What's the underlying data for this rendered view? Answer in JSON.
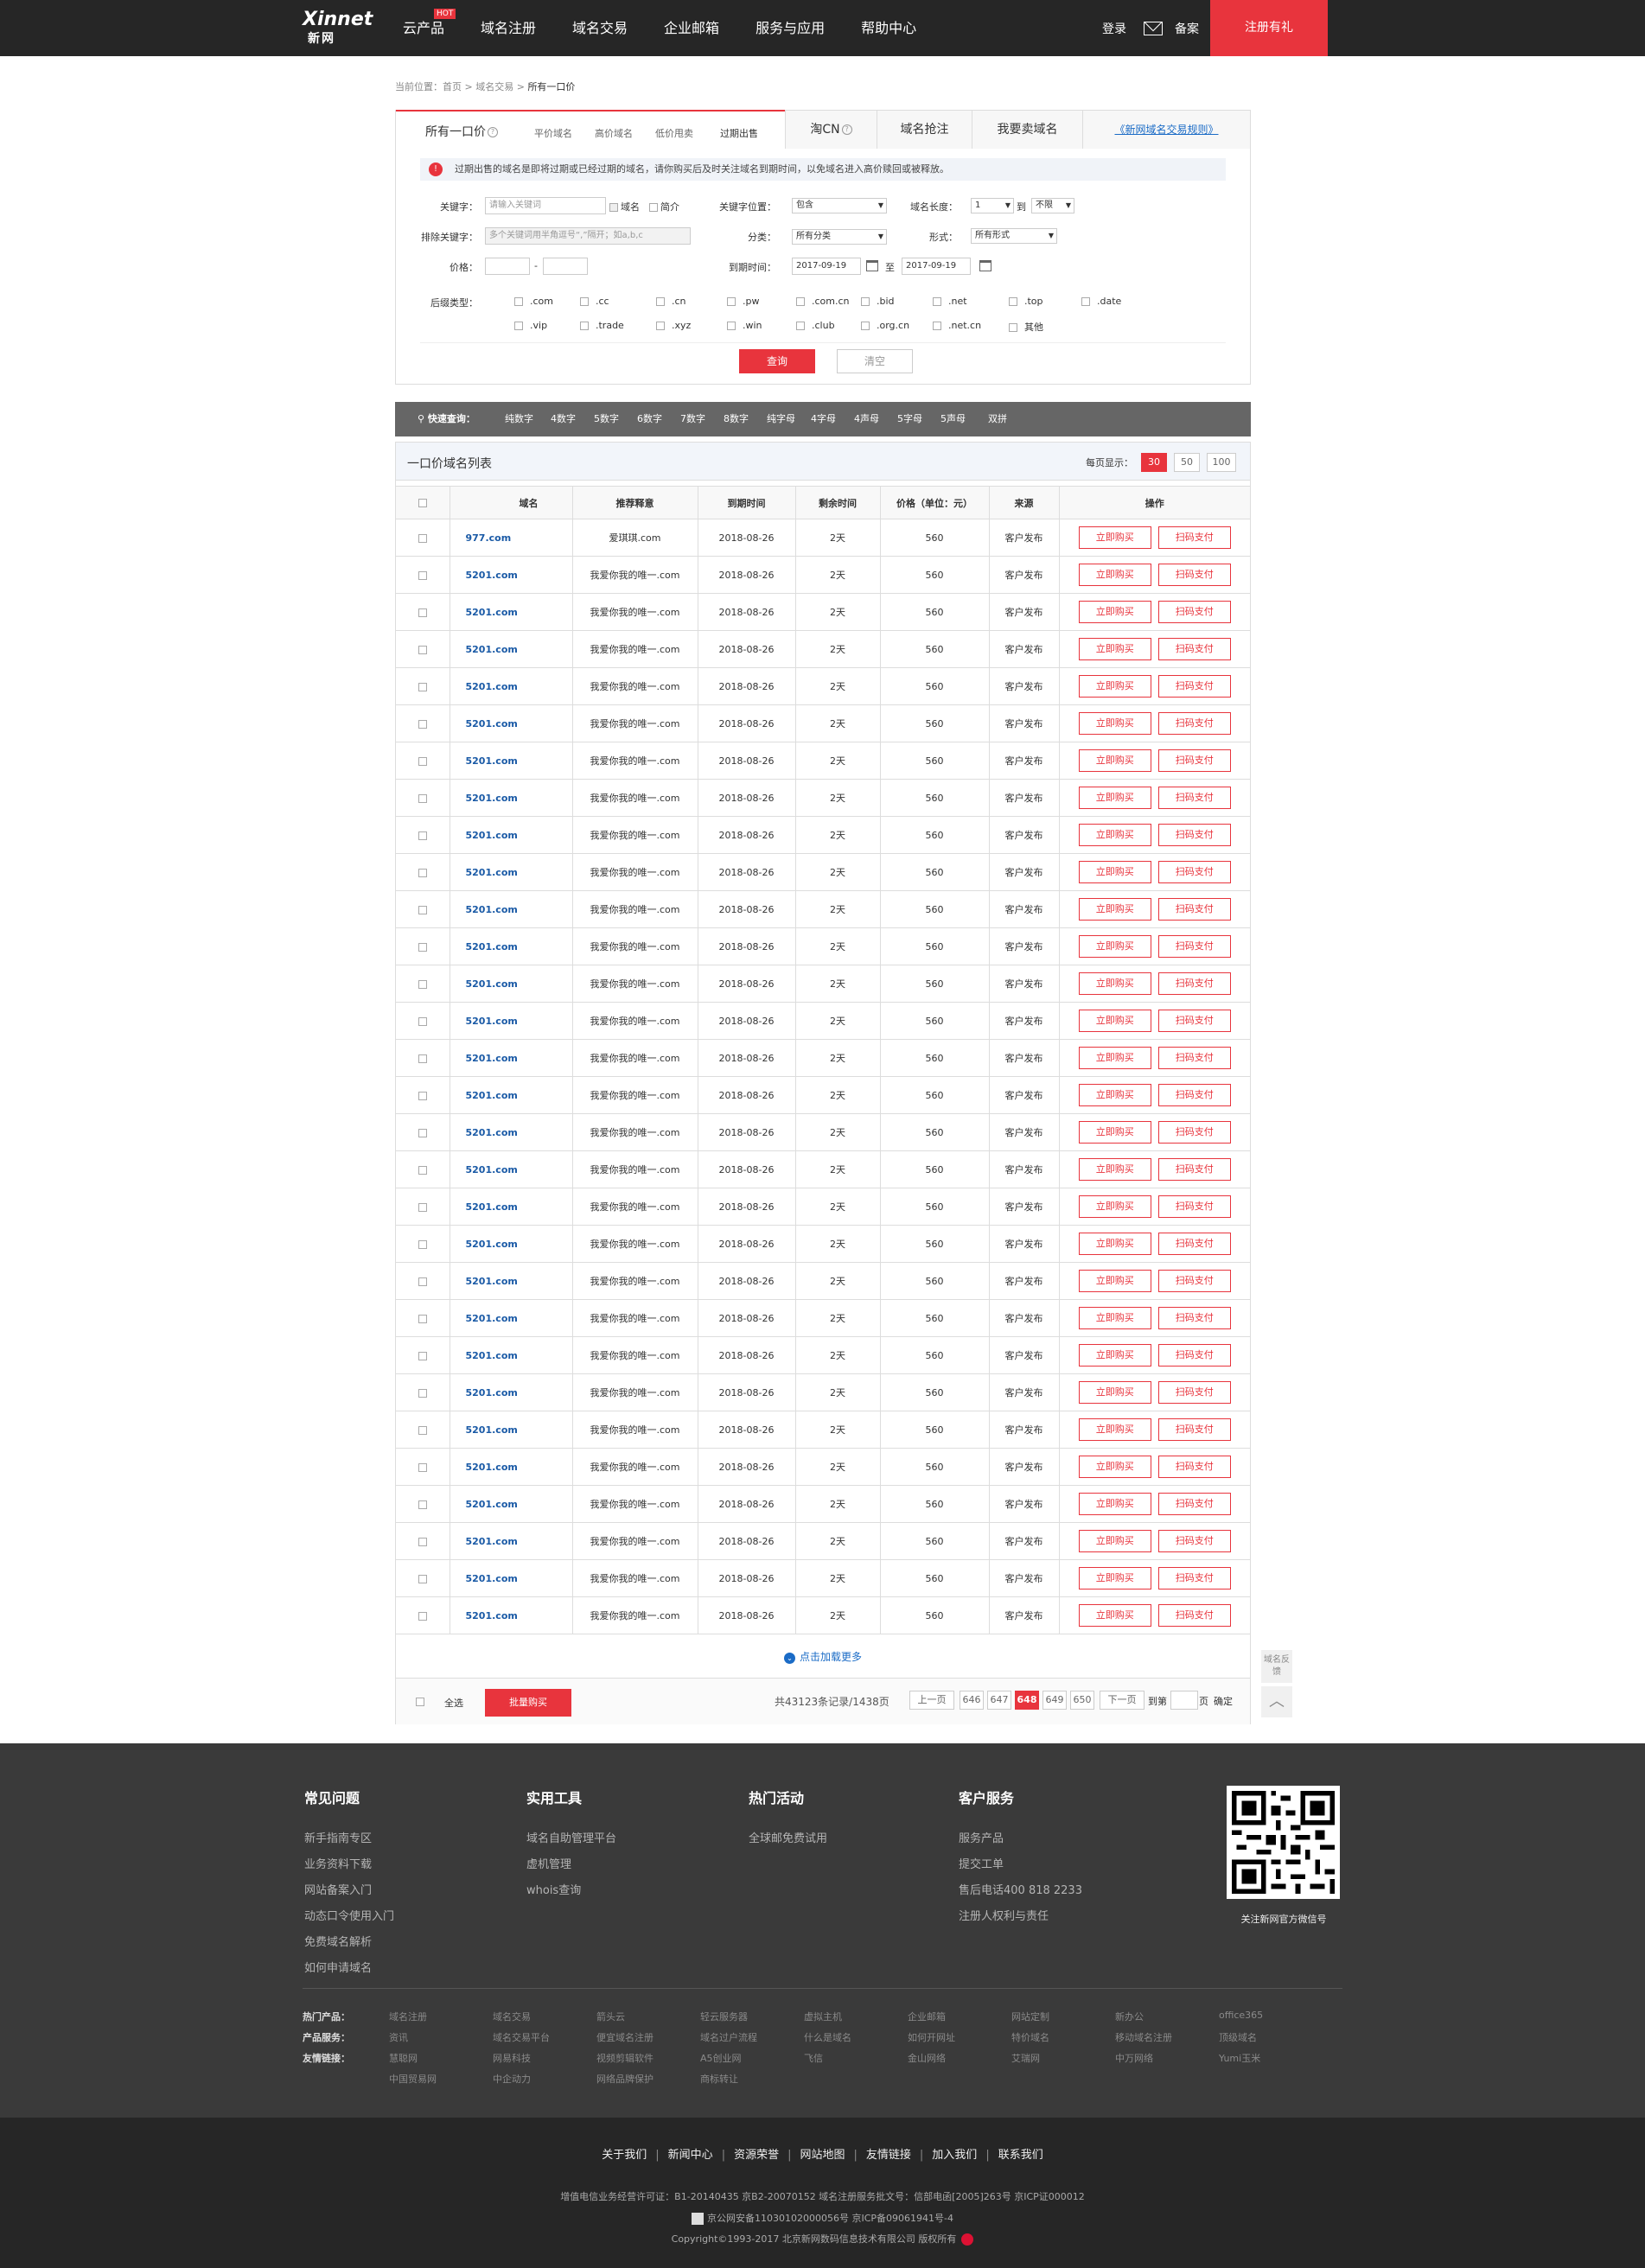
{
  "header": {
    "logo_en": "Xinnet",
    "logo_cn": "新网",
    "nav": [
      "云产品",
      "域名注册",
      "域名交易",
      "企业邮箱",
      "服务与应用",
      "帮助中心"
    ],
    "hot_badge": "HOT",
    "login": "登录",
    "beian": "备案",
    "register": "注册有礼"
  },
  "breadcrumb": {
    "prefix": "当前位置：",
    "home": "首页",
    "sep1": " > ",
    "trade": "域名交易",
    "sep2": " > ",
    "current": "所有一口价"
  },
  "tabs": {
    "main": "所有一口价",
    "subs": [
      "平价域名",
      "高价域名",
      "低价甩卖",
      "过期出售"
    ],
    "taocn": "淘CN",
    "qiangzhu": "域名抢注",
    "sell": "我要卖域名",
    "rules": "《新网域名交易规则》"
  },
  "notice": {
    "icon": "!",
    "text": "过期出售的域名是即将过期或已经过期的域名，请你购买后及时关注域名到期时间，以免域名进入高价赎回或被释放。"
  },
  "form": {
    "keyword_label": "关键字：",
    "keyword_placeholder": "请输入关键词",
    "chk_domain": "域名",
    "chk_intro": "简介",
    "kwpos_label": "关键字位置：",
    "kwpos_value": "包含",
    "len_label": "域名长度：",
    "len_from": "1",
    "len_to_word": "到",
    "len_to": "不限",
    "exclude_label": "排除关键字：",
    "exclude_placeholder": "多个关键词用半角逗号“,”隔开；如a,b,c",
    "category_label": "分类：",
    "category_value": "所有分类",
    "form_label": "形式：",
    "form_value": "所有形式",
    "price_label": "价格：",
    "price_dash": "-",
    "expire_label": "到期时间：",
    "date_from": "2017-09-19",
    "date_to_word": "至",
    "date_to": "2017-09-19",
    "suffix_label": "后缀类型：",
    "suffixes_row1": [
      ".com",
      ".cc",
      ".cn",
      ".pw",
      ".com.cn",
      ".bid",
      ".net",
      ".top",
      ".date"
    ],
    "suffixes_row2": [
      ".vip",
      ".trade",
      ".xyz",
      ".win",
      ".club",
      ".org.cn",
      ".net.cn",
      "其他"
    ],
    "btn_query": "查询",
    "btn_clear": "清空"
  },
  "quick": {
    "title": "快速查询：",
    "items": [
      "纯数字",
      "4数字",
      "5数字",
      "6数字",
      "7数字",
      "8数字",
      "纯字母",
      "4字母",
      "4声母",
      "5字母",
      "5声母",
      "双拼"
    ]
  },
  "list": {
    "title": "一口价域名列表",
    "per_page_label": "每页显示：",
    "per_page": [
      "30",
      "50",
      "100"
    ],
    "per_page_selected": "30",
    "columns": [
      "域名",
      "推荐释意",
      "到期时间",
      "剩余时间",
      "价格（单位：元）",
      "来源",
      "操作"
    ],
    "buy": "立即购买",
    "scan": "扫码支付",
    "rows": [
      {
        "domain": "977.com",
        "meaning": "爱琪琪.com",
        "expire": "2018-08-26",
        "remain": "2天",
        "price": "560",
        "source": "客户发布"
      },
      {
        "domain": "5201.com",
        "meaning": "我爱你我的唯一.com",
        "expire": "2018-08-26",
        "remain": "2天",
        "price": "560",
        "source": "客户发布"
      },
      {
        "domain": "5201.com",
        "meaning": "我爱你我的唯一.com",
        "expire": "2018-08-26",
        "remain": "2天",
        "price": "560",
        "source": "客户发布"
      },
      {
        "domain": "5201.com",
        "meaning": "我爱你我的唯一.com",
        "expire": "2018-08-26",
        "remain": "2天",
        "price": "560",
        "source": "客户发布"
      },
      {
        "domain": "5201.com",
        "meaning": "我爱你我的唯一.com",
        "expire": "2018-08-26",
        "remain": "2天",
        "price": "560",
        "source": "客户发布"
      },
      {
        "domain": "5201.com",
        "meaning": "我爱你我的唯一.com",
        "expire": "2018-08-26",
        "remain": "2天",
        "price": "560",
        "source": "客户发布"
      },
      {
        "domain": "5201.com",
        "meaning": "我爱你我的唯一.com",
        "expire": "2018-08-26",
        "remain": "2天",
        "price": "560",
        "source": "客户发布"
      },
      {
        "domain": "5201.com",
        "meaning": "我爱你我的唯一.com",
        "expire": "2018-08-26",
        "remain": "2天",
        "price": "560",
        "source": "客户发布"
      },
      {
        "domain": "5201.com",
        "meaning": "我爱你我的唯一.com",
        "expire": "2018-08-26",
        "remain": "2天",
        "price": "560",
        "source": "客户发布"
      },
      {
        "domain": "5201.com",
        "meaning": "我爱你我的唯一.com",
        "expire": "2018-08-26",
        "remain": "2天",
        "price": "560",
        "source": "客户发布"
      },
      {
        "domain": "5201.com",
        "meaning": "我爱你我的唯一.com",
        "expire": "2018-08-26",
        "remain": "2天",
        "price": "560",
        "source": "客户发布"
      },
      {
        "domain": "5201.com",
        "meaning": "我爱你我的唯一.com",
        "expire": "2018-08-26",
        "remain": "2天",
        "price": "560",
        "source": "客户发布"
      },
      {
        "domain": "5201.com",
        "meaning": "我爱你我的唯一.com",
        "expire": "2018-08-26",
        "remain": "2天",
        "price": "560",
        "source": "客户发布"
      },
      {
        "domain": "5201.com",
        "meaning": "我爱你我的唯一.com",
        "expire": "2018-08-26",
        "remain": "2天",
        "price": "560",
        "source": "客户发布"
      },
      {
        "domain": "5201.com",
        "meaning": "我爱你我的唯一.com",
        "expire": "2018-08-26",
        "remain": "2天",
        "price": "560",
        "source": "客户发布"
      },
      {
        "domain": "5201.com",
        "meaning": "我爱你我的唯一.com",
        "expire": "2018-08-26",
        "remain": "2天",
        "price": "560",
        "source": "客户发布"
      },
      {
        "domain": "5201.com",
        "meaning": "我爱你我的唯一.com",
        "expire": "2018-08-26",
        "remain": "2天",
        "price": "560",
        "source": "客户发布"
      },
      {
        "domain": "5201.com",
        "meaning": "我爱你我的唯一.com",
        "expire": "2018-08-26",
        "remain": "2天",
        "price": "560",
        "source": "客户发布"
      },
      {
        "domain": "5201.com",
        "meaning": "我爱你我的唯一.com",
        "expire": "2018-08-26",
        "remain": "2天",
        "price": "560",
        "source": "客户发布"
      },
      {
        "domain": "5201.com",
        "meaning": "我爱你我的唯一.com",
        "expire": "2018-08-26",
        "remain": "2天",
        "price": "560",
        "source": "客户发布"
      },
      {
        "domain": "5201.com",
        "meaning": "我爱你我的唯一.com",
        "expire": "2018-08-26",
        "remain": "2天",
        "price": "560",
        "source": "客户发布"
      },
      {
        "domain": "5201.com",
        "meaning": "我爱你我的唯一.com",
        "expire": "2018-08-26",
        "remain": "2天",
        "price": "560",
        "source": "客户发布"
      },
      {
        "domain": "5201.com",
        "meaning": "我爱你我的唯一.com",
        "expire": "2018-08-26",
        "remain": "2天",
        "price": "560",
        "source": "客户发布"
      },
      {
        "domain": "5201.com",
        "meaning": "我爱你我的唯一.com",
        "expire": "2018-08-26",
        "remain": "2天",
        "price": "560",
        "source": "客户发布"
      },
      {
        "domain": "5201.com",
        "meaning": "我爱你我的唯一.com",
        "expire": "2018-08-26",
        "remain": "2天",
        "price": "560",
        "source": "客户发布"
      },
      {
        "domain": "5201.com",
        "meaning": "我爱你我的唯一.com",
        "expire": "2018-08-26",
        "remain": "2天",
        "price": "560",
        "source": "客户发布"
      },
      {
        "domain": "5201.com",
        "meaning": "我爱你我的唯一.com",
        "expire": "2018-08-26",
        "remain": "2天",
        "price": "560",
        "source": "客户发布"
      },
      {
        "domain": "5201.com",
        "meaning": "我爱你我的唯一.com",
        "expire": "2018-08-26",
        "remain": "2天",
        "price": "560",
        "source": "客户发布"
      },
      {
        "domain": "5201.com",
        "meaning": "我爱你我的唯一.com",
        "expire": "2018-08-26",
        "remain": "2天",
        "price": "560",
        "source": "客户发布"
      },
      {
        "domain": "5201.com",
        "meaning": "我爱你我的唯一.com",
        "expire": "2018-08-26",
        "remain": "2天",
        "price": "560",
        "source": "客户发布"
      }
    ],
    "load_more": "点击加载更多",
    "select_all": "全选",
    "bulk_buy": "批量购买",
    "total": "共43123条记录/1438页",
    "prev": "上一页",
    "pages": [
      "646",
      "647",
      "648",
      "649",
      "650"
    ],
    "current_page": "648",
    "next": "下一页",
    "goto": "到第",
    "page_unit": "页",
    "confirm": "确定"
  },
  "side": {
    "feedback": "域名反馈",
    "top": "︿"
  },
  "footer": {
    "cols": [
      {
        "title": "常见问题",
        "links": [
          "新手指南专区",
          "业务资料下载",
          "网站备案入门",
          "动态口令使用入门",
          "免费域名解析",
          "如何申请域名"
        ]
      },
      {
        "title": "实用工具",
        "links": [
          "域名自助管理平台",
          "虚机管理",
          "whois查询"
        ]
      },
      {
        "title": "热门活动",
        "links": [
          "全球邮免费试用"
        ]
      },
      {
        "title": "客户服务",
        "links": [
          "服务产品",
          "提交工单",
          "售后电话400 818 2233",
          "注册人权利与责任"
        ]
      }
    ],
    "qr_caption": "关注新网官方微信号",
    "link_rows": [
      {
        "label": "热门产品：",
        "items": [
          "域名注册",
          "域名交易",
          "箭头云",
          "轻云服务器",
          "虚拟主机",
          "企业邮箱",
          "网站定制",
          "新办公",
          "office365"
        ]
      },
      {
        "label": "产品服务：",
        "items": [
          "资讯",
          "域名交易平台",
          "便宜域名注册",
          "域名过户流程",
          "什么是域名",
          "如何开网址",
          "特价域名",
          "移动域名注册",
          "顶级域名"
        ]
      },
      {
        "label": "友情链接：",
        "items": [
          "慧聪网",
          "网易科技",
          "视频剪辑软件",
          "A5创业网",
          "飞信",
          "金山网络",
          "艾瑞网",
          "中万网络",
          "Yumi玉米"
        ]
      },
      {
        "label": "",
        "items": [
          "中国贸易网",
          "中企动力",
          "网络品牌保护",
          "商标转让"
        ]
      }
    ],
    "bottom_nav": [
      "关于我们",
      "新闻中心",
      "资源荣誉",
      "网站地图",
      "友情链接",
      "加入我们",
      "联系我们"
    ],
    "license": "增值电信业务经营许可证：B1-20140435 京B2-20070152 域名注册服务批文号：信部电函[2005]263号 京ICP证000012",
    "police": "京公网安备11030102000056号 京ICP备09061941号-4",
    "copyright": "Copyright©1993-2017 北京新网数码信息技术有限公司 版权所有"
  }
}
